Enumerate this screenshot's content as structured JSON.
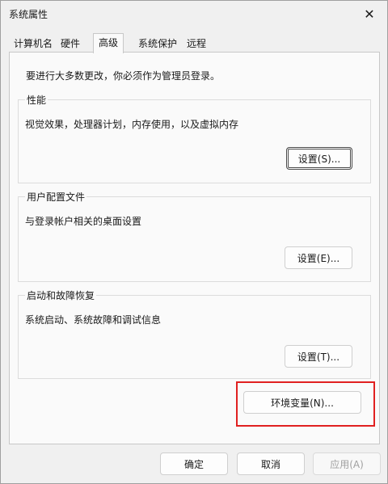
{
  "window": {
    "title": "系统属性"
  },
  "tabs": [
    {
      "label": "计算机名"
    },
    {
      "label": "硬件"
    },
    {
      "label": "高级"
    },
    {
      "label": "系统保护"
    },
    {
      "label": "远程"
    }
  ],
  "active_tab": "高级",
  "panel": {
    "intro": "要进行大多数更改，你必须作为管理员登录。",
    "performance": {
      "legend": "性能",
      "description": "视觉效果，处理器计划，内存使用，以及虚拟内存",
      "button": "设置(S)..."
    },
    "user_profiles": {
      "legend": "用户配置文件",
      "description": "与登录帐户相关的桌面设置",
      "button": "设置(E)..."
    },
    "startup_recovery": {
      "legend": "启动和故障恢复",
      "description": "系统启动、系统故障和调试信息",
      "button": "设置(T)..."
    },
    "env_button": "环境变量(N)..."
  },
  "footer": {
    "ok": "确定",
    "cancel": "取消",
    "apply": "应用(A)"
  },
  "colors": {
    "highlight": "#e02020",
    "background": "#f0f0f0",
    "panel": "#fafafa"
  },
  "icons": {
    "close": "close-icon"
  }
}
